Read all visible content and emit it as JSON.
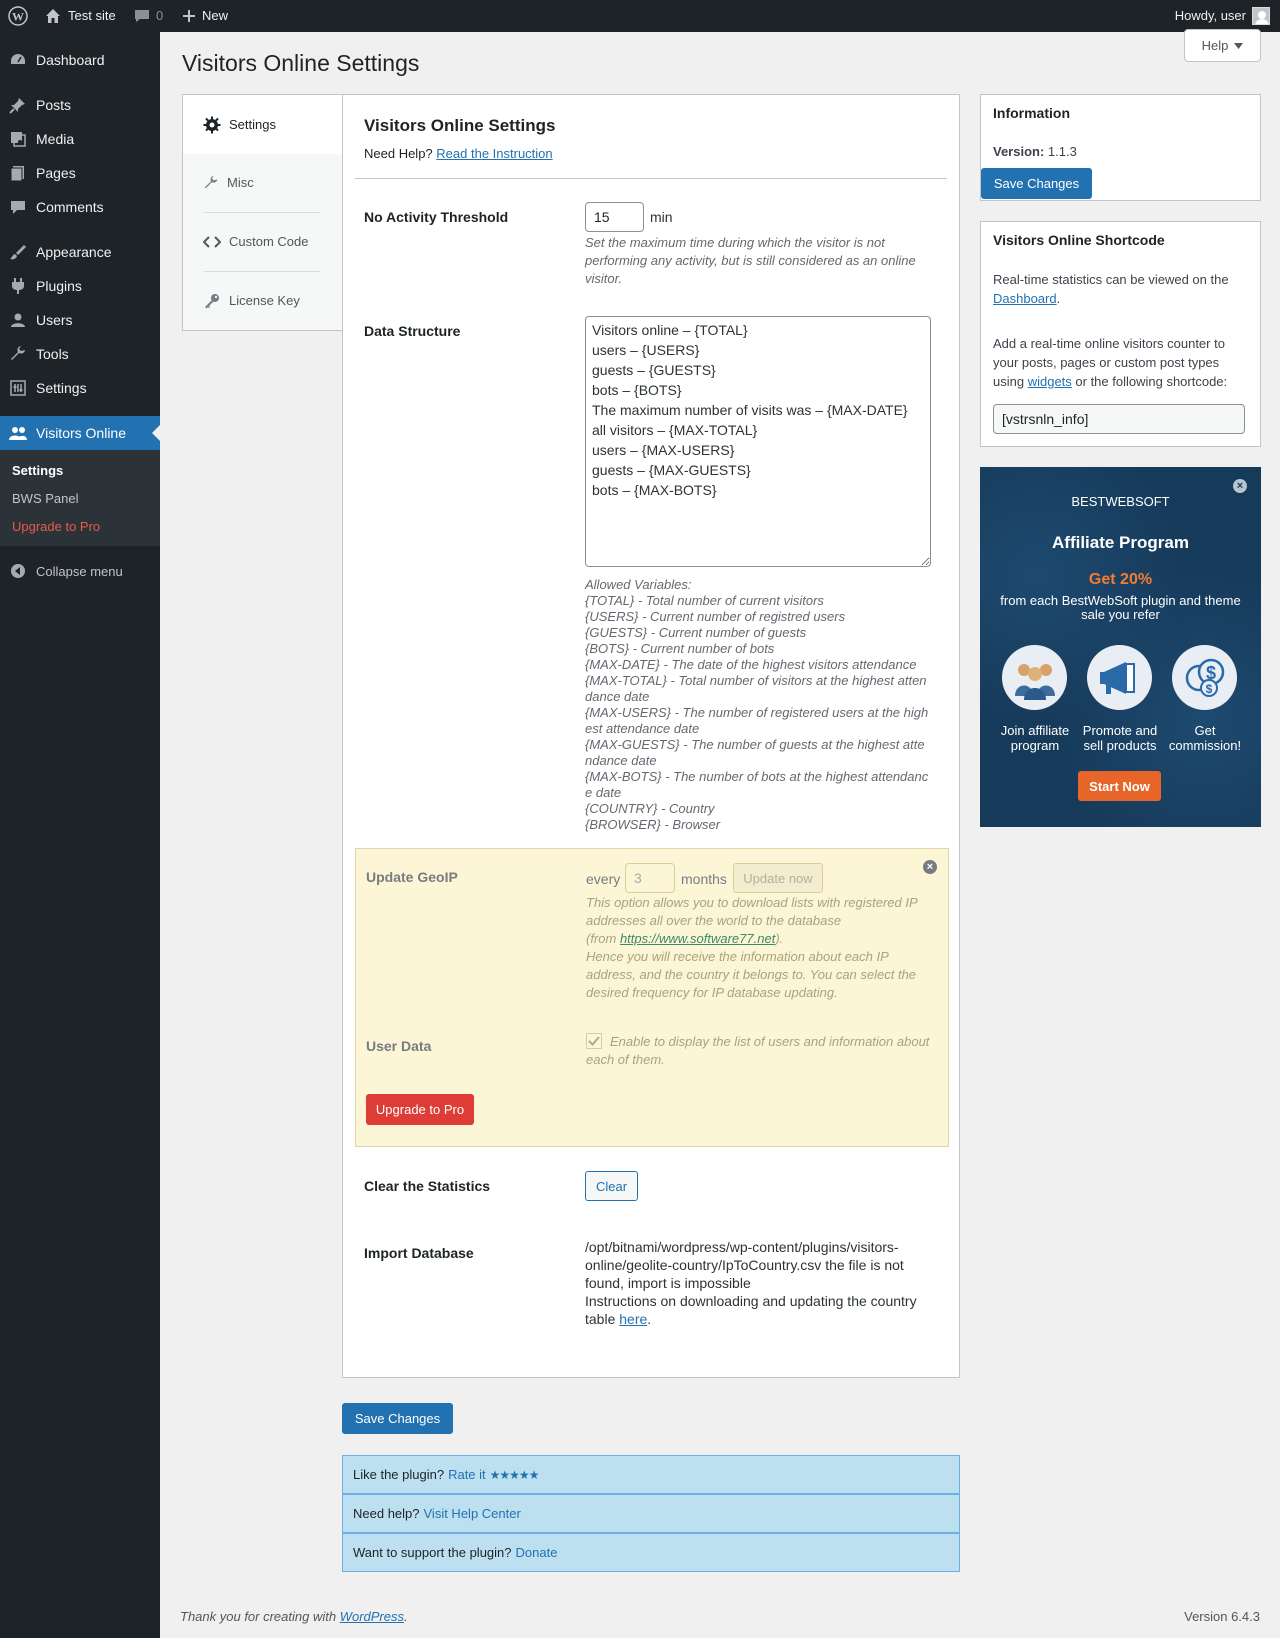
{
  "admin_bar": {
    "site_name": "Test site",
    "comments_count": "0",
    "new_label": "New",
    "howdy": "Howdy, user"
  },
  "menu": {
    "items": [
      {
        "label": "Dashboard",
        "icon": "dashboard-icon"
      },
      {
        "label": "Posts",
        "icon": "pin-icon"
      },
      {
        "label": "Media",
        "icon": "media-icon"
      },
      {
        "label": "Pages",
        "icon": "pages-icon"
      },
      {
        "label": "Comments",
        "icon": "comments-icon"
      },
      {
        "label": "Appearance",
        "icon": "brush-icon"
      },
      {
        "label": "Plugins",
        "icon": "plug-icon"
      },
      {
        "label": "Users",
        "icon": "users-icon"
      },
      {
        "label": "Tools",
        "icon": "wrench-icon"
      },
      {
        "label": "Settings",
        "icon": "settings-icon"
      },
      {
        "label": "Visitors Online",
        "icon": "visitors-icon"
      }
    ],
    "submenu": [
      "Settings",
      "BWS Panel",
      "Upgrade to Pro"
    ],
    "collapse": "Collapse menu"
  },
  "page": {
    "title": "Visitors Online Settings",
    "help": "Help"
  },
  "tabs": [
    "Settings",
    "Misc",
    "Custom Code",
    "License Key"
  ],
  "settings": {
    "title": "Visitors Online Settings",
    "need_help": "Need Help?",
    "read_instruction": "Read the Instruction",
    "threshold_label": "No Activity Threshold",
    "threshold_value": "15",
    "threshold_unit": "min",
    "threshold_desc": "Set the maximum time during which the visitor is not performing any activity, but is still considered as an online visitor.",
    "data_structure_label": "Data Structure",
    "data_structure_value": "Visitors online – {TOTAL}\nusers – {USERS}\nguests – {GUESTS}\nbots – {BOTS}\nThe maximum number of visits was – {MAX-DATE}\nall visitors – {MAX-TOTAL}\nusers – {MAX-USERS}\nguests – {MAX-GUESTS}\nbots – {MAX-BOTS}",
    "allowed_variables": [
      "Allowed Variables:",
      "{TOTAL} - Total number of current visitors",
      "{USERS} - Current number of registred users",
      "{GUESTS} - Current number of guests",
      "{BOTS} - Current number of bots",
      "{MAX-DATE} - The date of the highest visitors attendance",
      "{MAX-TOTAL} - Total number of visitors at the highest attendance date",
      "{MAX-USERS} - The number of registered users at the highest attendance date",
      "{MAX-GUESTS} - The number of guests at the highest attendance date",
      "{MAX-BOTS} - The number of bots at the highest attendance date",
      "{COUNTRY} - Country",
      "{BROWSER} - Browser"
    ],
    "geoip_label": "Update GeoIP",
    "geoip_every": "every",
    "geoip_value": "3",
    "geoip_months": "months",
    "geoip_update_btn": "Update now",
    "geoip_desc1": "This option allows you to download lists with registered IP addresses all over the world to the database",
    "geoip_from": "(from ",
    "geoip_link": "https://www.software77.net",
    "geoip_close": ").",
    "geoip_desc2": "Hence you will receive the information about each IP address, and the country it belongs to. You can select the desired frequency for IP database updating.",
    "user_data_label": "User Data",
    "user_data_desc": "Enable to display the list of users and information about each of them.",
    "upgrade_btn": "Upgrade to Pro",
    "clear_label": "Clear the Statistics",
    "clear_btn": "Clear",
    "import_label": "Import Database",
    "import_text": "/opt/bitnami/wordpress/wp-content/plugins/visitors-online/geolite-country/IpToCountry.csv the file is not found, import is impossible",
    "import_instr": "Instructions on downloading and updating the country table ",
    "import_here": "here",
    "import_dot": ".",
    "save_btn": "Save Changes"
  },
  "info_box": {
    "title": "Information",
    "version_label": "Version:",
    "version_value": "1.1.3",
    "save_btn": "Save Changes"
  },
  "shortcode_box": {
    "title": "Visitors Online Shortcode",
    "text1": "Real-time statistics can be viewed on the ",
    "dashboard_link": "Dashboard",
    "text1_end": ".",
    "text2a": "Add a real-time online visitors counter to your posts, pages or custom post types using ",
    "widgets_link": "widgets",
    "text2b": " or the following shortcode:",
    "shortcode": "[vstrsnln_info]"
  },
  "affiliate": {
    "brand": "BESTWEBSOFT",
    "title": "Affiliate Program",
    "get": "Get 20%",
    "sub": "from each BestWebSoft plugin and theme sale you refer",
    "items": [
      "Join affiliate program",
      "Promote and sell products",
      "Get commission!"
    ],
    "start": "Start Now",
    "accent": "#f47b30"
  },
  "bottom": {
    "like": "Like the plugin?",
    "rate": "Rate it",
    "help": "Need help?",
    "help_link": "Visit Help Center",
    "support": "Want to support the plugin?",
    "donate": "Donate"
  },
  "footer": {
    "thanks": "Thank you for creating with ",
    "wp": "WordPress",
    "dot": ".",
    "version": "Version 6.4.3"
  },
  "colors": {
    "admin_bg": "#1d2327",
    "primary": "#2271b1",
    "pro_bg": "#fcf6d7",
    "notice_bg": "#bde0f0"
  }
}
